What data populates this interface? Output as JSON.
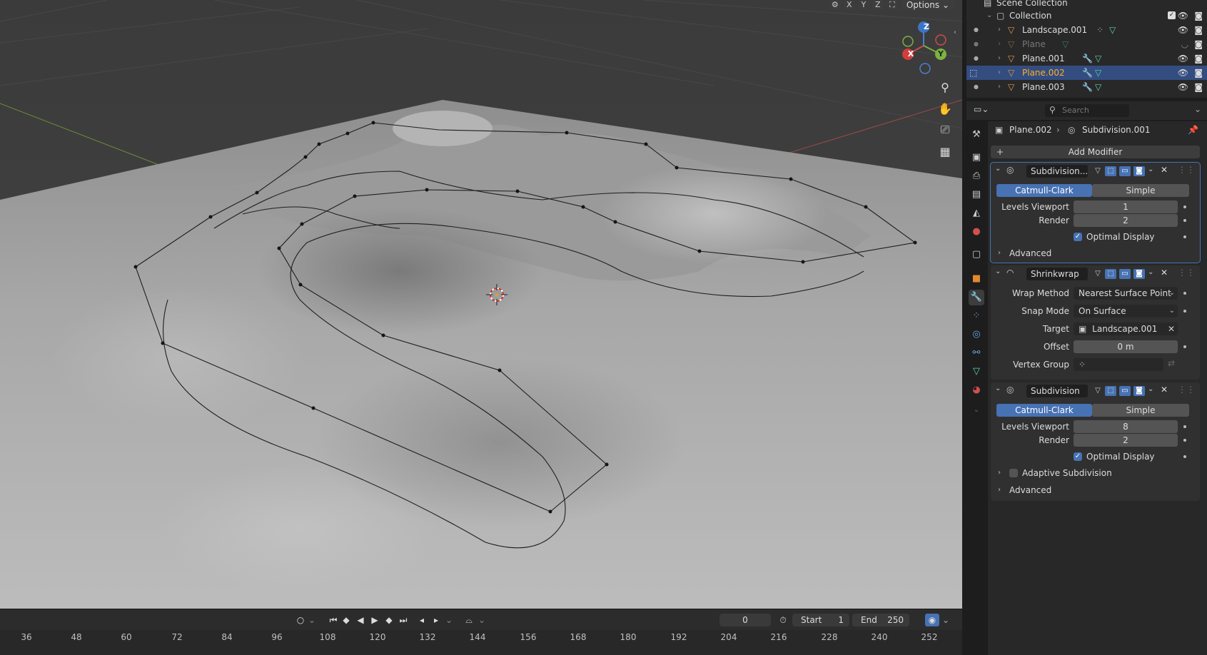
{
  "viewport": {
    "axis_buttons": [
      "X",
      "Y",
      "Z"
    ],
    "options_label": "Options",
    "gizmo": {
      "x": "X",
      "y": "Y",
      "z": "Z"
    }
  },
  "outliner": {
    "root": "Scene Collection",
    "collection": "Collection",
    "items": [
      {
        "name": "Landscape.001"
      },
      {
        "name": "Plane"
      },
      {
        "name": "Plane.001"
      },
      {
        "name": "Plane.002"
      },
      {
        "name": "Plane.003"
      }
    ]
  },
  "properties": {
    "search_placeholder": "Search",
    "breadcrumb": {
      "object": "Plane.002",
      "modifier": "Subdivision.001"
    },
    "add_modifier_label": "Add Modifier",
    "modifiers": [
      {
        "name": "Subdivision....",
        "mode_a": "Catmull-Clark",
        "mode_b": "Simple",
        "levels_viewport_label": "Levels Viewport",
        "levels_viewport": "1",
        "render_label": "Render",
        "render": "2",
        "optimal_display_label": "Optimal Display",
        "advanced_label": "Advanced"
      },
      {
        "name": "Shrinkwrap",
        "wrap_method_label": "Wrap Method",
        "wrap_method": "Nearest Surface Point",
        "snap_mode_label": "Snap Mode",
        "snap_mode": "On Surface",
        "target_label": "Target",
        "target": "Landscape.001",
        "offset_label": "Offset",
        "offset": "0 m",
        "vertex_group_label": "Vertex Group"
      },
      {
        "name": "Subdivision",
        "mode_a": "Catmull-Clark",
        "mode_b": "Simple",
        "levels_viewport_label": "Levels Viewport",
        "levels_viewport": "8",
        "render_label": "Render",
        "render": "2",
        "optimal_display_label": "Optimal Display",
        "adaptive_label": "Adaptive Subdivision",
        "advanced_label": "Advanced"
      }
    ]
  },
  "timeline": {
    "current_frame": "0",
    "start_label": "Start",
    "start": "1",
    "end_label": "End",
    "end": "250",
    "ruler": [
      "36",
      "48",
      "60",
      "72",
      "84",
      "96",
      "108",
      "120",
      "132",
      "144",
      "156",
      "168",
      "180",
      "192",
      "204",
      "216",
      "228",
      "240",
      "252"
    ]
  },
  "colors": {
    "accent": "#4772b3",
    "selection": "#334d80",
    "mesh_icon": "#5fd3a8"
  }
}
